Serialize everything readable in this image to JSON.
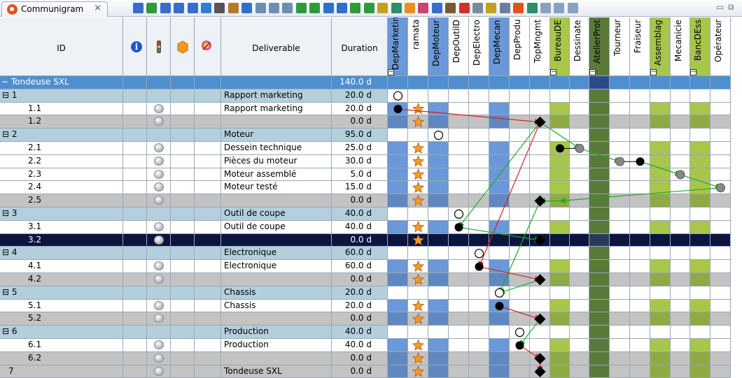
{
  "window": {
    "tab_title": "Communigram",
    "close_glyph": "⨯",
    "min_glyph": "▭",
    "max_glyph": "⧉"
  },
  "toolbar": {
    "icons": [
      "filter-icon",
      "indent-icon",
      "delete-icon",
      "preview-icon",
      "print-icon",
      "copy-icon",
      "cut-icon",
      "paste-icon",
      "move-up-icon",
      "move-down-icon",
      "move-left-icon",
      "move-right-icon",
      "expand-icon",
      "collapse-icon",
      "columns-icon",
      "rows-icon",
      "network-icon",
      "check-icon",
      "calendar-icon",
      "refresh-icon",
      "package-icon",
      "deliverable-icon",
      "transfer-icon",
      "resource-icon",
      "pie-icon",
      "status-icon",
      "users-icon",
      "report-icon",
      "database-icon",
      "chart-icon",
      "settings-icon",
      "tools-icon",
      "tools2-icon"
    ],
    "colors": [
      "#3a6bd0",
      "#2f9a3a",
      "#3a6bd0",
      "#3a6bd0",
      "#3a6bd0",
      "#2f7fd0",
      "#555555",
      "#b07a2a",
      "#2f6fd0",
      "#6f8fb0",
      "#6f8fb0",
      "#6f8fb0",
      "#2f9a3a",
      "#2f9a3a",
      "#2f6fd0",
      "#2f6fd0",
      "#2f9a3a",
      "#2f9a3a",
      "#c4a020",
      "#2a8f6a",
      "#e89020",
      "#d04070",
      "#3a6bd0",
      "#7a5a30",
      "#d03030",
      "#7a8a9a",
      "#c4a020",
      "#6a7fa0",
      "#e0531d",
      "#2a8f6a",
      "#8aa0c0",
      "#8aa0c0",
      "#8aa0c0"
    ]
  },
  "columns": {
    "id": "ID",
    "deliverable": "Deliverable",
    "duration": "Duration",
    "resources": [
      {
        "name": "DepMarketing",
        "color": "#6a98d8",
        "collapsible": true
      },
      {
        "name": "ramata",
        "color": "#ffffff",
        "collapsible": false
      },
      {
        "name": "DepMoteur",
        "color": "#6a98d8",
        "collapsible": false
      },
      {
        "name": "DepOutilD",
        "color": "#ffffff",
        "collapsible": false
      },
      {
        "name": "DepElectro",
        "color": "#ffffff",
        "collapsible": false
      },
      {
        "name": "DepMecan",
        "color": "#6a98d8",
        "collapsible": false
      },
      {
        "name": "DepProdu",
        "color": "#ffffff",
        "collapsible": false
      },
      {
        "name": "TopMngmt",
        "color": "#ffffff",
        "collapsible": false
      },
      {
        "name": "BureauDE",
        "color": "#a8c64a",
        "collapsible": true
      },
      {
        "name": "Dessinate",
        "color": "#ffffff",
        "collapsible": false
      },
      {
        "name": "AtelierProt",
        "color": "#5a7a3a",
        "collapsible": true
      },
      {
        "name": "Tourneur",
        "color": "#ffffff",
        "collapsible": false
      },
      {
        "name": "Fraiseur",
        "color": "#ffffff",
        "collapsible": false
      },
      {
        "name": "Assemblag",
        "color": "#a8c64a",
        "collapsible": true
      },
      {
        "name": "Mecanicie",
        "color": "#ffffff",
        "collapsible": false
      },
      {
        "name": "BancDEss",
        "color": "#a8c64a",
        "collapsible": true
      },
      {
        "name": "Opérateur",
        "color": "#ffffff",
        "collapsible": false
      }
    ]
  },
  "rows": [
    {
      "id": "Tondeuse SXL",
      "level": 0,
      "deliverable": "",
      "duration": "140.0 d",
      "type": "root"
    },
    {
      "id": "1",
      "level": 1,
      "deliverable": "Rapport marketing",
      "duration": "20.0 d",
      "type": "group"
    },
    {
      "id": "1.1",
      "level": 2,
      "deliverable": "Rapport marketing",
      "duration": "20.0 d",
      "type": "task"
    },
    {
      "id": "1.2",
      "level": 2,
      "deliverable": "",
      "duration": "0.0 d",
      "type": "milestone"
    },
    {
      "id": "2",
      "level": 1,
      "deliverable": "Moteur",
      "duration": "95.0 d",
      "type": "group"
    },
    {
      "id": "2.1",
      "level": 2,
      "deliverable": "Dessein technique",
      "duration": "25.0 d",
      "type": "task"
    },
    {
      "id": "2.2",
      "level": 2,
      "deliverable": "Pièces du moteur",
      "duration": "30.0 d",
      "type": "task"
    },
    {
      "id": "2.3",
      "level": 2,
      "deliverable": "Moteur assemblé",
      "duration": "5.0 d",
      "type": "task"
    },
    {
      "id": "2.4",
      "level": 2,
      "deliverable": "Moteur testé",
      "duration": "15.0 d",
      "type": "task"
    },
    {
      "id": "2.5",
      "level": 2,
      "deliverable": "",
      "duration": "0.0 d",
      "type": "milestone"
    },
    {
      "id": "3",
      "level": 1,
      "deliverable": "Outil de coupe",
      "duration": "40.0 d",
      "type": "group"
    },
    {
      "id": "3.1",
      "level": 2,
      "deliverable": "Outil de coupe",
      "duration": "40.0 d",
      "type": "task"
    },
    {
      "id": "3.2",
      "level": 2,
      "deliverable": "",
      "duration": "0.0 d",
      "type": "selected"
    },
    {
      "id": "4",
      "level": 1,
      "deliverable": "Electronique",
      "duration": "60.0 d",
      "type": "group"
    },
    {
      "id": "4.1",
      "level": 2,
      "deliverable": "Electronique",
      "duration": "60.0 d",
      "type": "task"
    },
    {
      "id": "4.2",
      "level": 2,
      "deliverable": "",
      "duration": "0.0 d",
      "type": "milestone"
    },
    {
      "id": "5",
      "level": 1,
      "deliverable": "Chassis",
      "duration": "20.0 d",
      "type": "group"
    },
    {
      "id": "5.1",
      "level": 2,
      "deliverable": "Chassis",
      "duration": "20.0 d",
      "type": "task"
    },
    {
      "id": "5.2",
      "level": 2,
      "deliverable": "",
      "duration": "0.0 d",
      "type": "milestone"
    },
    {
      "id": "6",
      "level": 1,
      "deliverable": "Production",
      "duration": "40.0 d",
      "type": "group"
    },
    {
      "id": "6.1",
      "level": 2,
      "deliverable": "Production",
      "duration": "40.0 d",
      "type": "task"
    },
    {
      "id": "6.2",
      "level": 2,
      "deliverable": "",
      "duration": "0.0 d",
      "type": "milestone"
    },
    {
      "id": "7",
      "level": 1,
      "deliverable": "Tondeuse SXL",
      "duration": "0.0 d",
      "type": "last"
    }
  ],
  "colors": {
    "root_bg": "#4f8fd0",
    "group_bg": "#b4cfdc",
    "task_bg": "#ffffff",
    "milestone_bg": "#c3c3c3",
    "selected_bg": "#0c1540",
    "selected_text": "#ffffff"
  }
}
